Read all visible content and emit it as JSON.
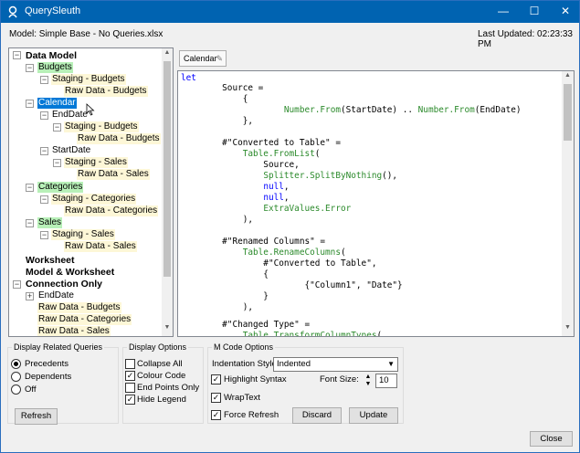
{
  "window": {
    "title": "QuerySleuth",
    "minimize": "—",
    "maximize": "☐",
    "close": "✕"
  },
  "header": {
    "model": "Model: Simple Base - No Queries.xlsx",
    "updated": "Last Updated: 02:23:33 PM"
  },
  "tree": {
    "n0": "Data Model",
    "n1": "Budgets",
    "n2": "Staging - Budgets",
    "n3": "Raw Data - Budgets",
    "n4": "Calendar",
    "n5": "EndDate",
    "n6": "Staging - Budgets",
    "n7": "Raw Data - Budgets",
    "n8": "StartDate",
    "n9": "Staging - Sales",
    "n10": "Raw Data - Sales",
    "n11": "Categories",
    "n12": "Staging - Categories",
    "n13": "Raw Data - Categories",
    "n14": "Sales",
    "n15": "Staging - Sales",
    "n16": "Raw Data - Sales",
    "n17": "Worksheet",
    "n18": "Model & Worksheet",
    "n19": "Connection Only",
    "n20": "EndDate",
    "n21": "Raw Data - Budgets",
    "n22": "Raw Data - Categories",
    "n23": "Raw Data - Sales"
  },
  "editor": {
    "tab": "Calendar"
  },
  "related": {
    "title": "Display Related Queries",
    "precedents": "Precedents",
    "dependents": "Dependents",
    "off": "Off",
    "selected": "precedents",
    "refresh": "Refresh"
  },
  "display": {
    "title": "Display Options",
    "collapse_all": "Collapse All",
    "colour_code": "Colour Code",
    "end_points_only": "End Points Only",
    "hide_legend": "Hide Legend"
  },
  "mcode": {
    "title": "M Code Options",
    "indent_label": "Indentation Style:",
    "indent_value": "Indented",
    "highlight": "Highlight Syntax",
    "font_size_label": "Font Size:",
    "font_size": "10",
    "wrap": "WrapText",
    "force_refresh": "Force Refresh",
    "discard": "Discard",
    "update": "Update"
  },
  "footer": {
    "close": "Close"
  }
}
